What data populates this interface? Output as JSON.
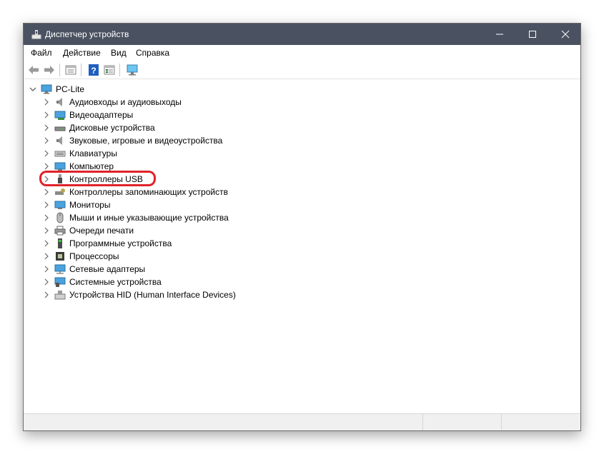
{
  "window": {
    "title": "Диспетчер устройств"
  },
  "menu": {
    "file": "Файл",
    "action": "Действие",
    "view": "Вид",
    "help": "Справка"
  },
  "toolbar": {
    "buttons": [
      "back-arrow-icon",
      "forward-arrow-icon",
      "properties-icon",
      "help-icon",
      "details-view-icon",
      "monitor-scan-icon"
    ]
  },
  "tree": {
    "root": "PC-Lite",
    "items": [
      {
        "label": "Аудиовходы и аудиовыходы",
        "icon": "speaker-icon"
      },
      {
        "label": "Видеоадаптеры",
        "icon": "display-adapter-icon"
      },
      {
        "label": "Дисковые устройства",
        "icon": "disk-drive-icon"
      },
      {
        "label": "Звуковые, игровые и видеоустройства",
        "icon": "sound-icon"
      },
      {
        "label": "Клавиатуры",
        "icon": "keyboard-icon"
      },
      {
        "label": "Компьютер",
        "icon": "computer-icon"
      },
      {
        "label": "Контроллеры USB",
        "icon": "usb-icon"
      },
      {
        "label": "Контроллеры запоминающих устройств",
        "icon": "storage-controller-icon"
      },
      {
        "label": "Мониторы",
        "icon": "monitor-icon"
      },
      {
        "label": "Мыши и иные указывающие устройства",
        "icon": "mouse-icon"
      },
      {
        "label": "Очереди печати",
        "icon": "printer-icon"
      },
      {
        "label": "Программные устройства",
        "icon": "software-device-icon"
      },
      {
        "label": "Процессоры",
        "icon": "processor-icon"
      },
      {
        "label": "Сетевые адаптеры",
        "icon": "network-adapter-icon"
      },
      {
        "label": "Системные устройства",
        "icon": "system-device-icon"
      },
      {
        "label": "Устройства HID (Human Interface Devices)",
        "icon": "hid-icon"
      }
    ]
  },
  "colors": {
    "titlebar": "#4a5261",
    "highlight": "#e0232a"
  }
}
